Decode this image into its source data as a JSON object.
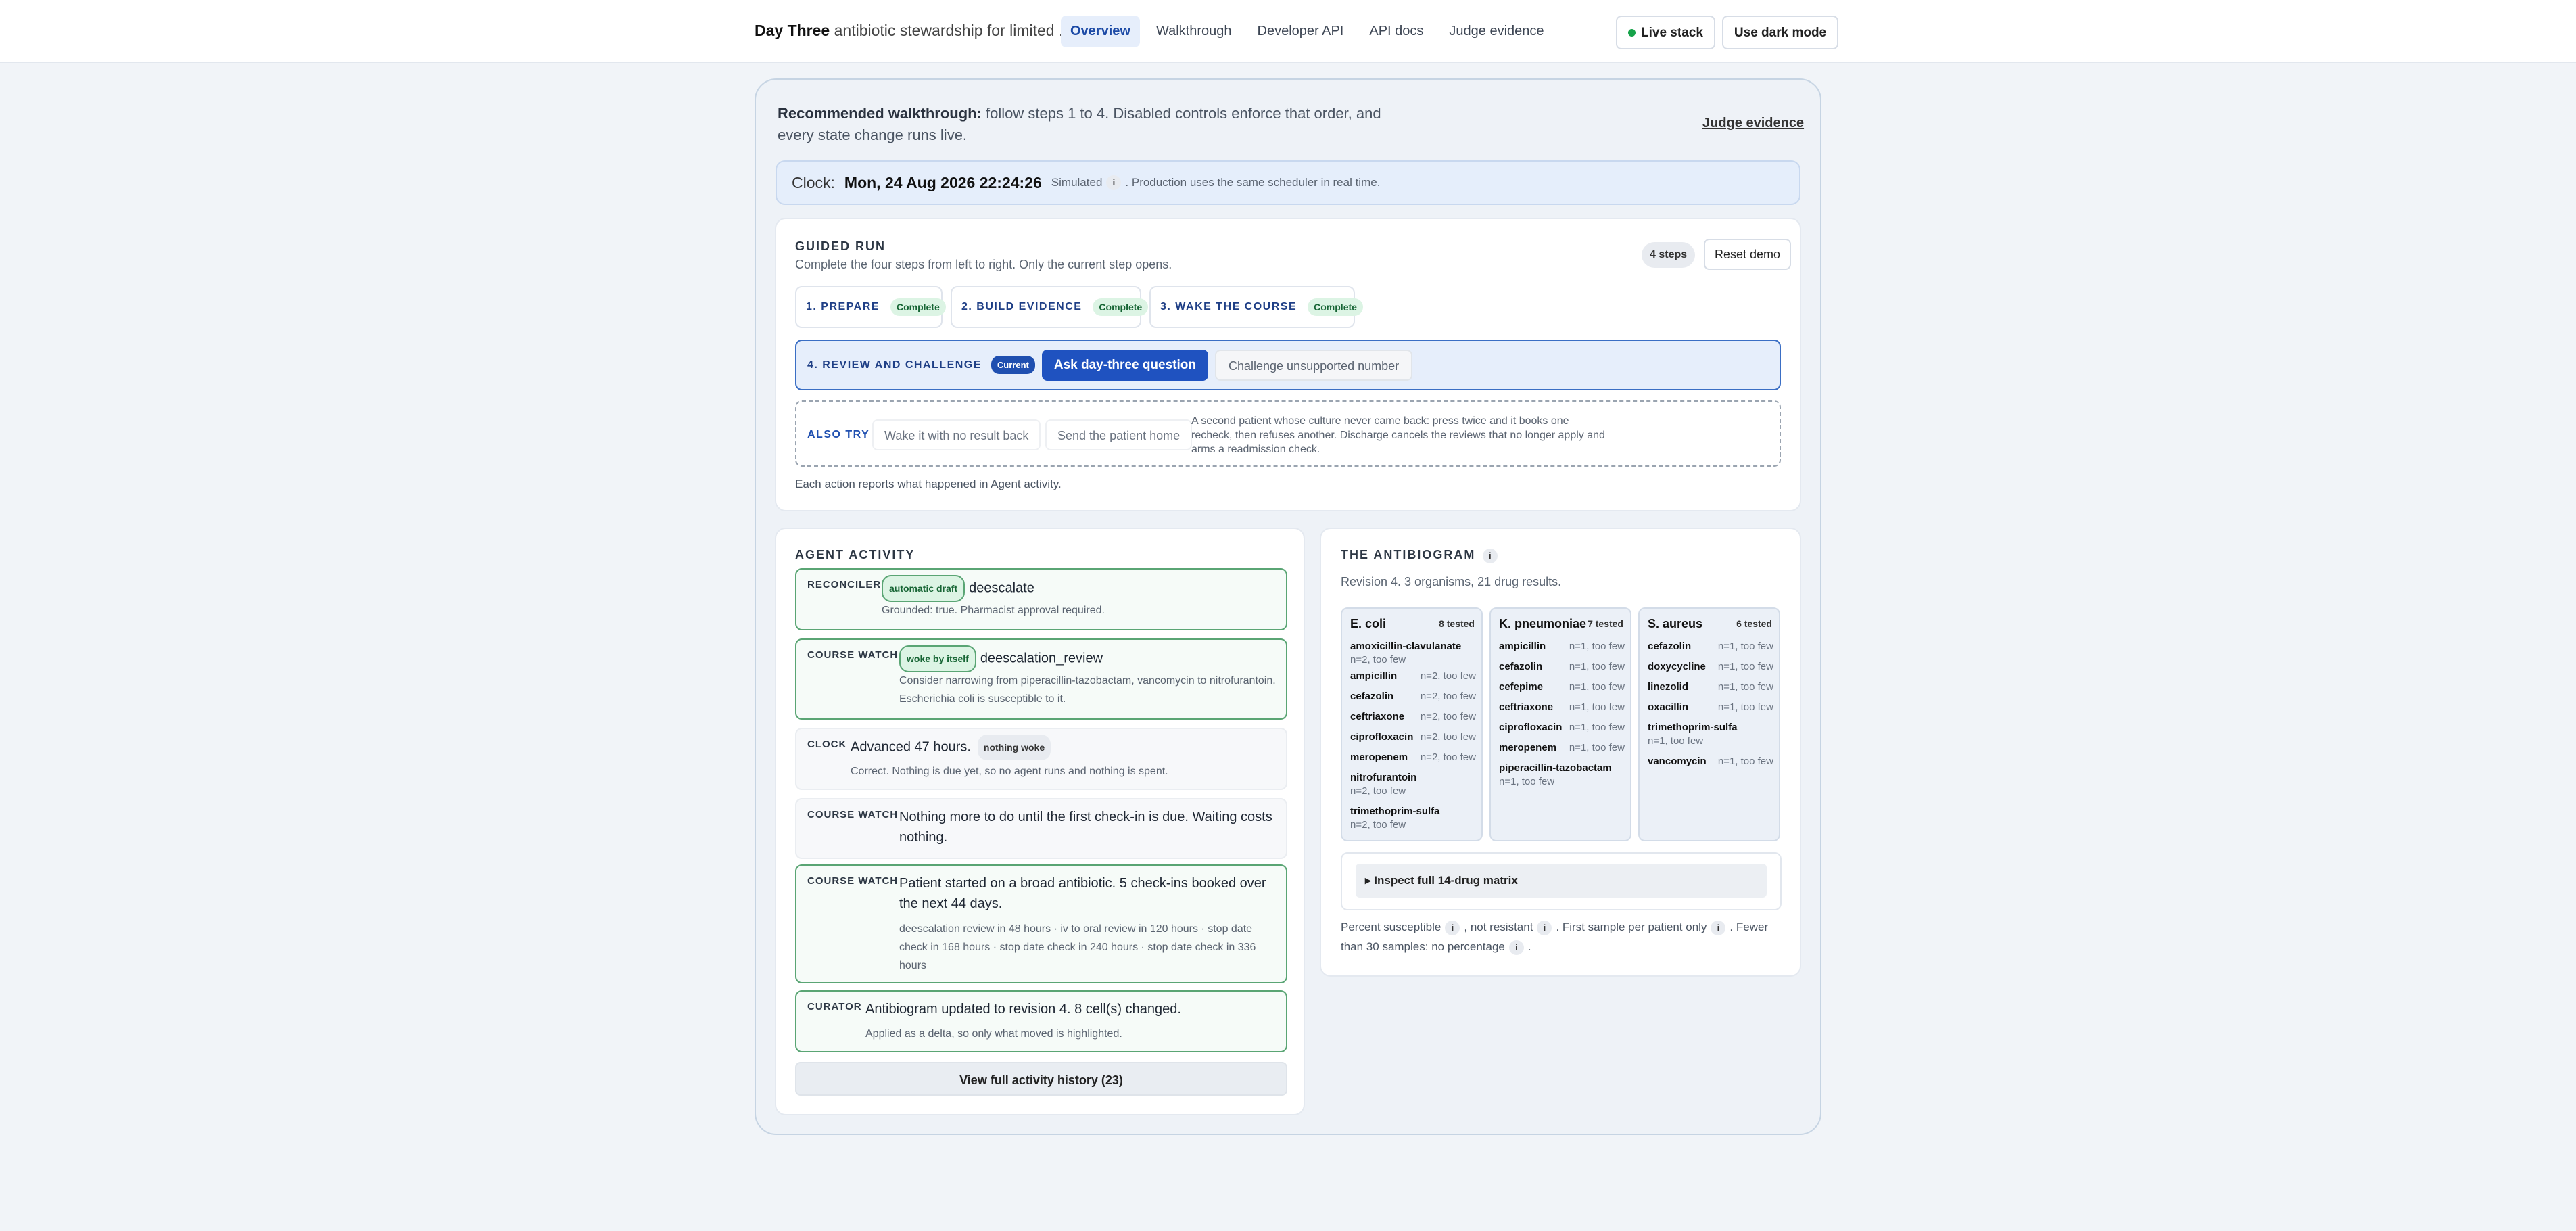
{
  "header": {
    "brand": "Day Three",
    "tagline": "antibiotic stewardship for limited ...",
    "nav": [
      "Overview",
      "Walkthrough",
      "Developer API",
      "API docs",
      "Judge evidence"
    ],
    "live_stack": "Live stack",
    "dark_mode": "Use dark mode",
    "live_color": "#16a34a"
  },
  "intro": {
    "bold": "Recommended walkthrough:",
    "text": "follow steps 1 to 4. Disabled controls enforce that order, and every state change runs live.",
    "judge_link": "Judge evidence"
  },
  "clock": {
    "label": "Clock:",
    "value": "Mon, 24 Aug 2026 22:24:26",
    "simulated": "Simulated",
    "note": ". Production uses the same scheduler in real time."
  },
  "guided": {
    "title": "GUIDED RUN",
    "subtitle": "Complete the four steps from left to right. Only the current step opens.",
    "steps_count": "4 steps",
    "reset": "Reset demo",
    "steps": [
      {
        "label": "1. PREPARE",
        "badge": "Complete"
      },
      {
        "label": "2. BUILD EVIDENCE",
        "badge": "Complete"
      },
      {
        "label": "3. WAKE THE COURSE",
        "badge": "Complete"
      }
    ],
    "current": {
      "label": "4. REVIEW AND CHALLENGE",
      "badge": "Current",
      "primary": "Ask day-three question",
      "secondary": "Challenge unsupported number"
    },
    "also": {
      "label": "ALSO TRY",
      "option1": "Wake it with no result back",
      "option2": "Send the patient home",
      "desc": "A second patient whose culture never came back: press twice and it books one recheck, then refuses another. Discharge cancels the reviews that no longer apply and arms a readmission check."
    },
    "footer": "Each action reports what happened in Agent activity."
  },
  "activity": {
    "title": "AGENT ACTIVITY",
    "entries": [
      {
        "tag": "RECONCILER",
        "badge": "automatic draft",
        "title": "deescalate",
        "note": "Grounded: true. Pharmacist approval required."
      },
      {
        "tag": "COURSE WATCH",
        "badge": "woke by itself",
        "title": "deescalation_review",
        "note": "Consider narrowing from piperacillin-tazobactam, vancomycin to nitrofurantoin. Escherichia coli is susceptible to it."
      },
      {
        "tag": "CLOCK",
        "title": "Advanced 47 hours.",
        "badge": "nothing woke",
        "note": "Correct. Nothing is due yet, so no agent runs and nothing is spent."
      },
      {
        "tag": "COURSE WATCH",
        "title": "Nothing more to do until the first check-in is due. Waiting costs nothing."
      },
      {
        "tag": "COURSE WATCH",
        "title": "Patient started on a broad antibiotic. 5 check-ins booked over the next 44 days.",
        "note": "deescalation review in 48 hours · iv to oral review in 120 hours · stop date check in 168 hours · stop date check in 240 hours · stop date check in 336 hours"
      },
      {
        "tag": "CURATOR",
        "title": "Antibiogram updated to revision 4. 8 cell(s) changed.",
        "note": "Applied as a delta, so only what moved is highlighted."
      }
    ],
    "view_all": "View full activity history (23)"
  },
  "antibiogram": {
    "title": "THE ANTIBIOGRAM",
    "revision": "Revision 4. 3 organisms, 21 drug results.",
    "organisms": [
      {
        "name": "E. coli",
        "tested": "8 tested",
        "drugs": [
          {
            "drug": "amoxicillin-clavulanate",
            "n": "n=2, too few",
            "wrap": true
          },
          {
            "drug": "ampicillin",
            "n": "n=2, too few"
          },
          {
            "drug": "cefazolin",
            "n": "n=2, too few"
          },
          {
            "drug": "ceftriaxone",
            "n": "n=2, too few"
          },
          {
            "drug": "ciprofloxacin",
            "n": "n=2, too few"
          },
          {
            "drug": "meropenem",
            "n": "n=2, too few"
          },
          {
            "drug": "nitrofurantoin",
            "n": "n=2, too few",
            "wrap": true
          },
          {
            "drug": "trimethoprim-sulfa",
            "n": "n=2, too few",
            "wrap": true
          }
        ]
      },
      {
        "name": "K. pneumoniae",
        "tested": "7 tested",
        "drugs": [
          {
            "drug": "ampicillin",
            "n": "n=1, too few"
          },
          {
            "drug": "cefazolin",
            "n": "n=1, too few"
          },
          {
            "drug": "cefepime",
            "n": "n=1, too few"
          },
          {
            "drug": "ceftriaxone",
            "n": "n=1, too few"
          },
          {
            "drug": "ciprofloxacin",
            "n": "n=1, too few"
          },
          {
            "drug": "meropenem",
            "n": "n=1, too few"
          },
          {
            "drug": "piperacillin-tazobactam",
            "n": "n=1, too few",
            "wrap": true
          }
        ]
      },
      {
        "name": "S. aureus",
        "tested": "6 tested",
        "drugs": [
          {
            "drug": "cefazolin",
            "n": "n=1, too few"
          },
          {
            "drug": "doxycycline",
            "n": "n=1, too few"
          },
          {
            "drug": "linezolid",
            "n": "n=1, too few"
          },
          {
            "drug": "oxacillin",
            "n": "n=1, too few"
          },
          {
            "drug": "trimethoprim-sulfa",
            "n": "n=1, too few",
            "wrap": true
          },
          {
            "drug": "vancomycin",
            "n": "n=1, too few"
          }
        ]
      }
    ],
    "inspect": "▸ Inspect full 14-drug matrix",
    "foot1": "Percent susceptible",
    "foot2": ", not resistant",
    "foot3": ". First sample per patient only",
    "foot4": ". Fewer than 30 samples: no percentage",
    "foot5": "."
  }
}
